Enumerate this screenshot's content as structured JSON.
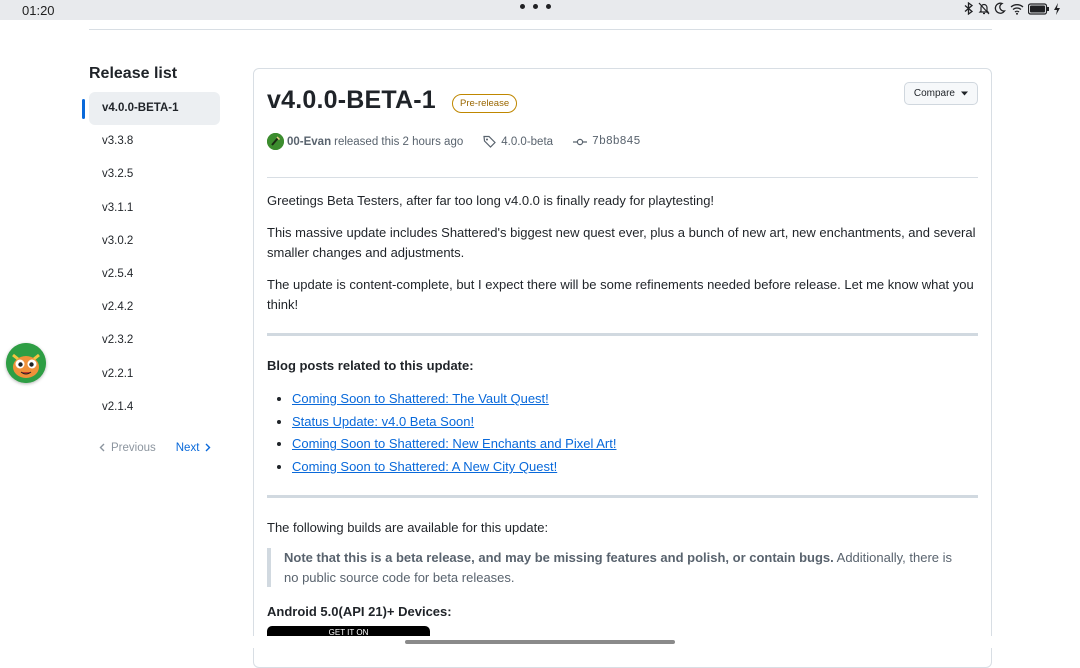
{
  "status_bar": {
    "time": "01:20"
  },
  "sidebar": {
    "title": "Release list",
    "items": [
      {
        "label": "v4.0.0-BETA-1",
        "active": true
      },
      {
        "label": "v3.3.8"
      },
      {
        "label": "v3.2.5"
      },
      {
        "label": "v3.1.1"
      },
      {
        "label": "v3.0.2"
      },
      {
        "label": "v2.5.4"
      },
      {
        "label": "v2.4.2"
      },
      {
        "label": "v2.3.2"
      },
      {
        "label": "v2.2.1"
      },
      {
        "label": "v2.1.4"
      }
    ],
    "pager": {
      "previous": "Previous",
      "next": "Next"
    }
  },
  "release": {
    "title": "v4.0.0-BETA-1",
    "badge": "Pre-release",
    "compare_label": "Compare",
    "author": "00-Evan",
    "released_text": "released this 2 hours ago",
    "tag": "4.0.0-beta",
    "commit": "7b8b845",
    "intro": "Greetings Beta Testers, after far too long v4.0.0 is finally ready for playtesting!",
    "para2": "This massive update includes Shattered's biggest new quest ever, plus a bunch of new art, new enchantments, and several smaller changes and adjustments.",
    "para3": "The update is content-complete, but I expect there will be some refinements needed before release. Let me know what you think!",
    "blog_heading": "Blog posts related to this update:",
    "blog_links": [
      "Coming Soon to Shattered: The Vault Quest!",
      "Status Update: v4.0 Beta Soon!",
      "Coming Soon to Shattered: New Enchants and Pixel Art!",
      "Coming Soon to Shattered: A New City Quest!"
    ],
    "builds_text": "The following builds are available for this update:",
    "note_bold": "Note that this is a beta release, and may be missing features and polish, or contain bugs.",
    "note_rest": " Additionally, there is no public source code for beta releases.",
    "android_heading": "Android 5.0(API 21)+ Devices:",
    "gplay_text": "GET IT ON"
  },
  "colors": {
    "accent": "#0969da",
    "badge": "#9a6700"
  }
}
